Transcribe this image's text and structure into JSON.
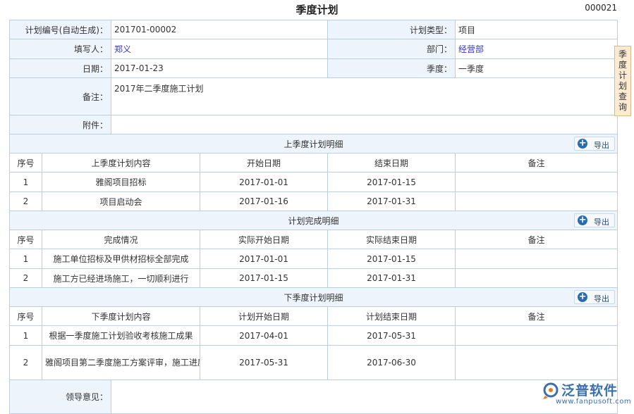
{
  "header": {
    "title": "季度计划",
    "doc_no": "000021"
  },
  "side_tab": {
    "chars": [
      "季",
      "度",
      "计",
      "划",
      "查",
      "询"
    ]
  },
  "form": {
    "plan_no_label": "计划编号(自动生成)：",
    "plan_no": "201701-00002",
    "plan_type_label": "计划类型：",
    "plan_type": "项目",
    "author_label": "填写人：",
    "author": "郑义",
    "dept_label": "部门：",
    "dept": "经营部",
    "date_label": "日期：",
    "date": "2017-01-23",
    "quarter_label": "季度：",
    "quarter": "一季度",
    "note_label": "备注：",
    "note": "2017年二季度施工计划",
    "attach_label": "附件：",
    "leader_label": "领导意见："
  },
  "export_label": "导出",
  "sections": [
    {
      "title": "上季度计划明细",
      "headers": [
        "序号",
        "上季度计划内容",
        "开始日期",
        "结束日期",
        "备注"
      ],
      "rows": [
        {
          "no": "1",
          "content": "雅阁项目招标",
          "start": "2017-01-01",
          "end": "2017-01-15",
          "note": ""
        },
        {
          "no": "2",
          "content": "项目启动会",
          "start": "2017-01-16",
          "end": "2017-01-31",
          "note": ""
        }
      ]
    },
    {
      "title": "计划完成明细",
      "headers": [
        "序号",
        "完成情况",
        "实际开始日期",
        "实际结束日期",
        "备注"
      ],
      "rows": [
        {
          "no": "1",
          "content": "施工单位招标及甲供材招标全部完成",
          "start": "2017-01-01",
          "end": "2017-01-15",
          "note": ""
        },
        {
          "no": "2",
          "content": "施工方已经进场施工，一切顺利进行",
          "start": "2017-01-15",
          "end": "2017-01-31",
          "note": ""
        }
      ]
    },
    {
      "title": "下季度计划明细",
      "headers": [
        "序号",
        "下季度计划内容",
        "计划开始日期",
        "计划结束日期",
        "备注"
      ],
      "rows": [
        {
          "no": "1",
          "content": "根据一季度施工计划验收考核施工成果",
          "start": "2017-04-01",
          "end": "2017-05-31",
          "note": ""
        },
        {
          "no": "2",
          "content": "雅阁项目第二季度施工方案评审，施工进度督促",
          "start": "2017-05-31",
          "end": "2017-06-30",
          "note": ""
        }
      ]
    }
  ],
  "logo": {
    "name": "泛普软件",
    "url": "www.fanpusoft.com"
  }
}
